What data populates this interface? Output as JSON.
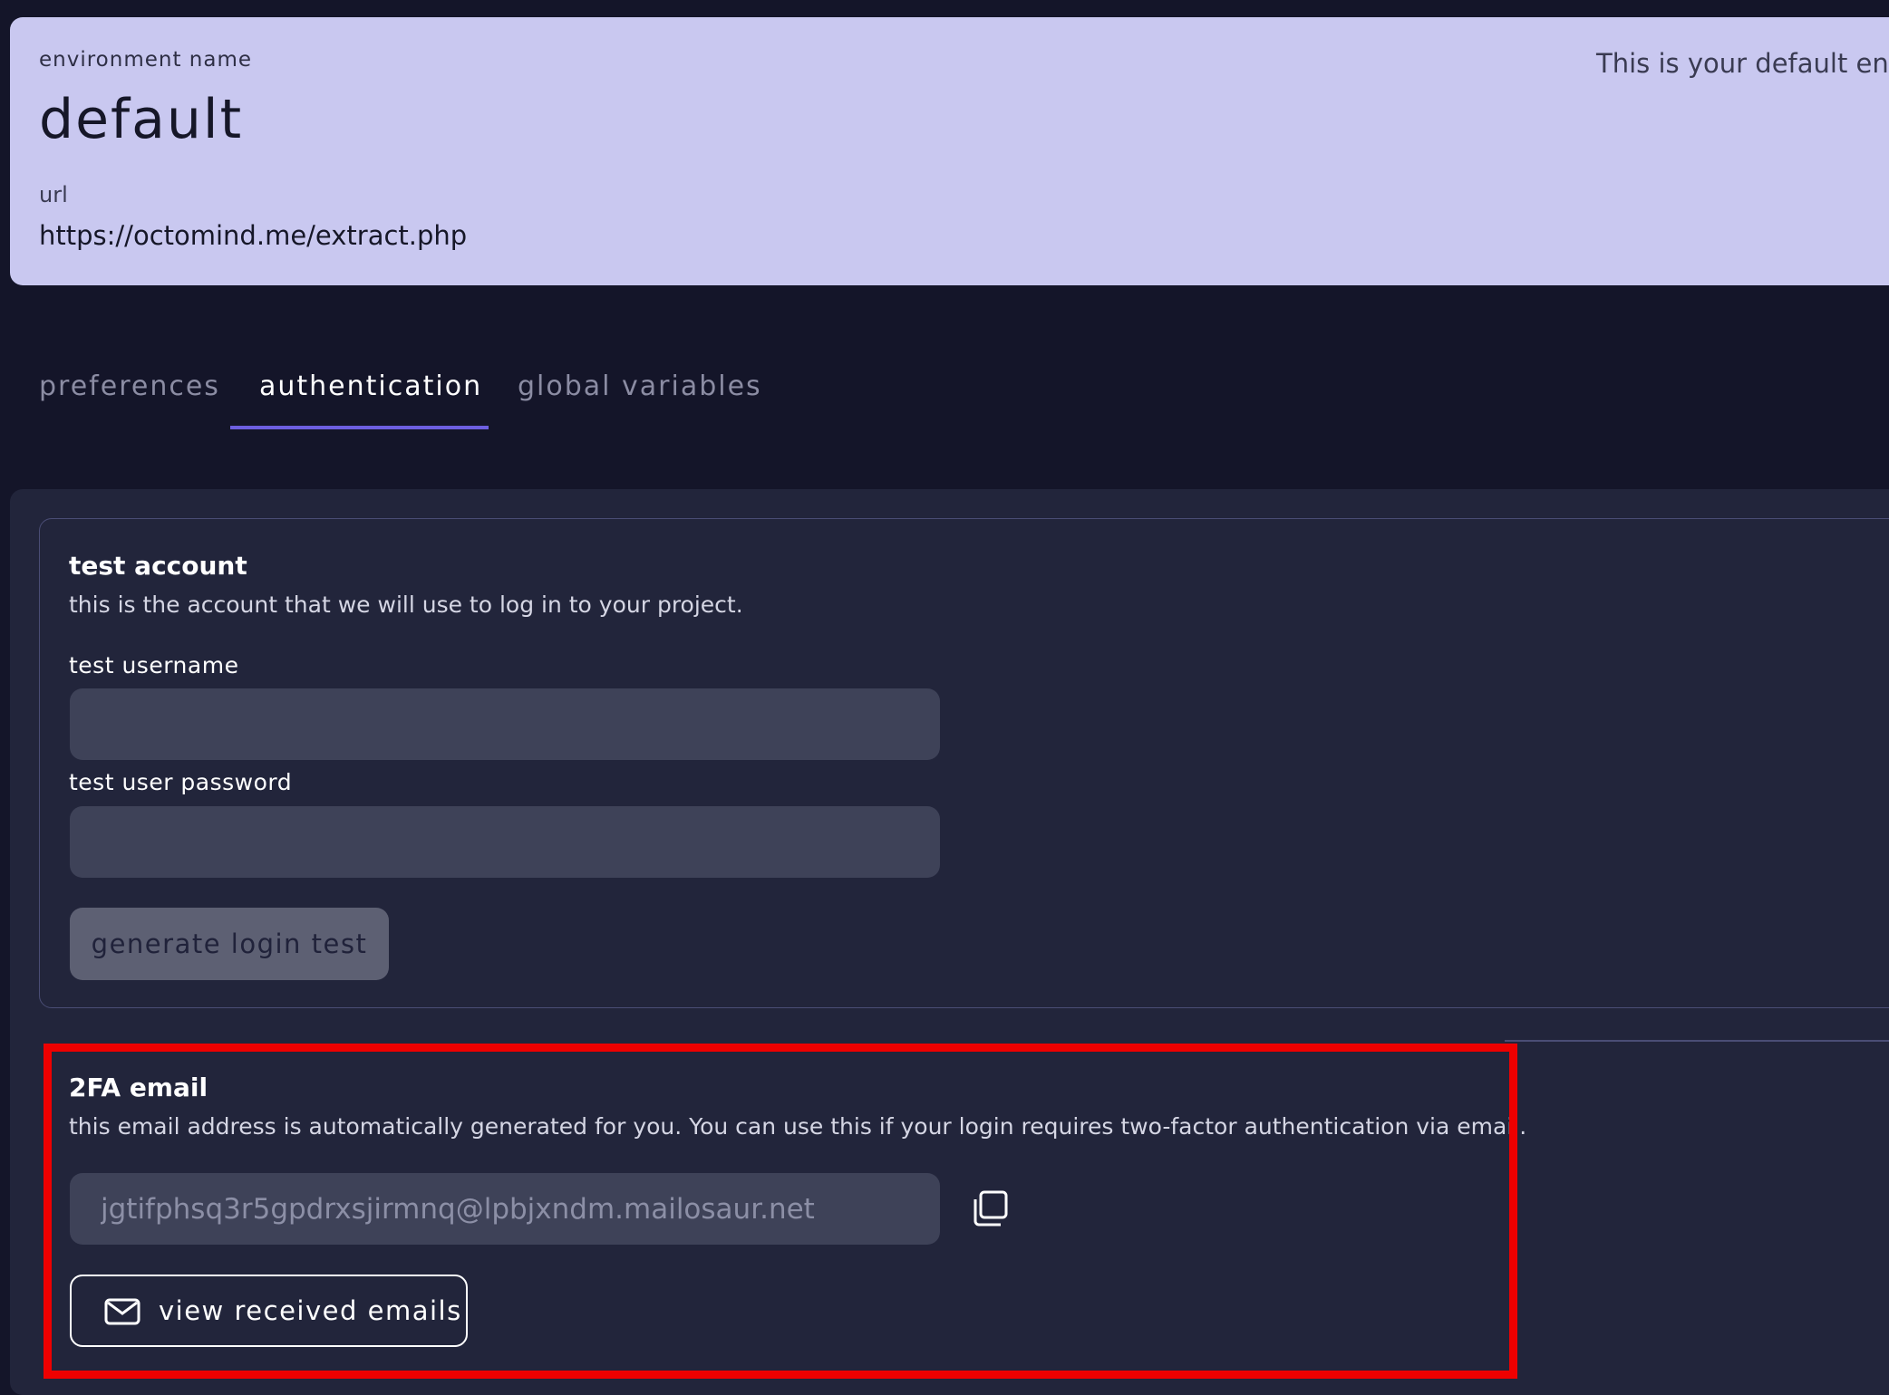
{
  "environment": {
    "name_label": "environment name",
    "name": "default",
    "url_label": "url",
    "url": "https://octomind.me/extract.php",
    "description": "This is your default envi"
  },
  "tabs": [
    {
      "label": "preferences",
      "active": false
    },
    {
      "label": "authentication",
      "active": true
    },
    {
      "label": "global variables",
      "active": false
    }
  ],
  "test_account": {
    "title": "test account",
    "description": "this is the account that we will use to log in to your project.",
    "username_label": "test username",
    "username_value": "",
    "password_label": "test user password",
    "password_value": "",
    "generate_button": "generate login test"
  },
  "twofa": {
    "title": "2FA email",
    "description": "this email address is automatically generated for you. You can use this if your login requires two-factor authentication via email.",
    "email": "jgtifphsq3r5gpdrxsjirmnq@lpbjxndm.mailosaur.net",
    "view_button": "view received emails"
  },
  "icons": {
    "copy": "copy-icon",
    "mail": "mail-icon"
  },
  "colors": {
    "background": "#141529",
    "env_card": "#c9c8f0",
    "panel": "#22253b",
    "tab_underline": "#6d5fe0",
    "highlight": "#ee0000"
  }
}
